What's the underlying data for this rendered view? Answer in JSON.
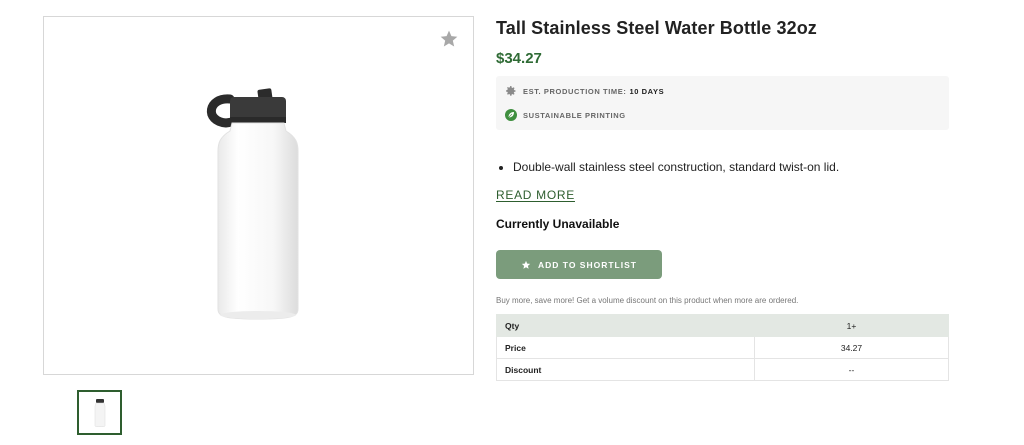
{
  "product": {
    "title": "Tall Stainless Steel Water Bottle 32oz",
    "price": "$34.27",
    "favorite_icon": "star-icon"
  },
  "badges": [
    {
      "icon": "gear-icon",
      "label": "Est. production time:",
      "value": "10 days"
    },
    {
      "icon": "leaf-icon",
      "label": "Sustainable printing"
    }
  ],
  "description": {
    "bullets": [
      "Double-wall stainless steel construction, standard twist-on lid."
    ],
    "read_more": "READ MORE"
  },
  "availability": "Currently Unavailable",
  "shortlist_button": {
    "label": "ADD TO SHORTLIST",
    "icon": "star-icon"
  },
  "volume_note": "Buy more, save more! Get a volume discount on this product when more are ordered.",
  "discount_table": {
    "rows": [
      {
        "label": "Qty",
        "value": "1+"
      },
      {
        "label": "Price",
        "value": "34.27"
      },
      {
        "label": "Discount",
        "value": "--"
      }
    ]
  },
  "colors": {
    "accent_green": "#2e5e2f",
    "price_green": "#2f6b35",
    "button_green": "#7b9c7c",
    "table_header": "#e3e8e3"
  }
}
